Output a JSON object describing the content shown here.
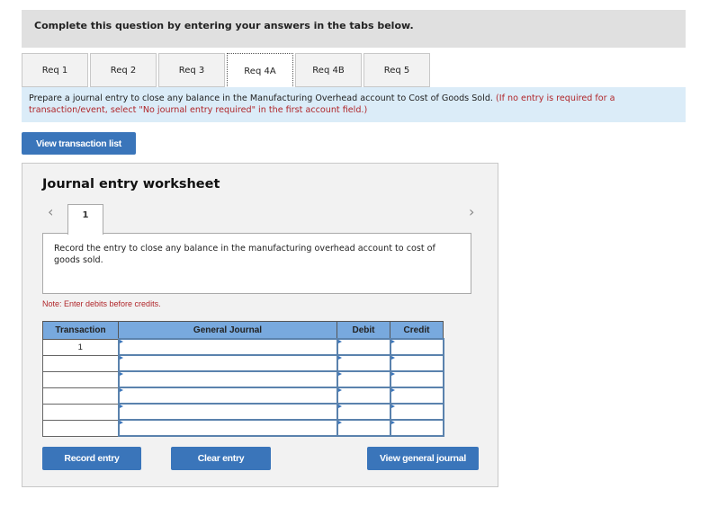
{
  "instruction": "Complete this question by entering your answers in the tabs below.",
  "tabs": [
    {
      "label": "Req 1",
      "active": false
    },
    {
      "label": "Req 2",
      "active": false
    },
    {
      "label": "Req 3",
      "active": false
    },
    {
      "label": "Req 4A",
      "active": true
    },
    {
      "label": "Req 4B",
      "active": false
    },
    {
      "label": "Req 5",
      "active": false
    }
  ],
  "prompt": {
    "main": "Prepare a journal entry to close any balance in the Manufacturing Overhead account to Cost of Goods Sold.",
    "hint": "(If no entry is required for a transaction/event, select \"No journal entry required\" in the first account field.)"
  },
  "view_transaction_list_label": "View transaction list",
  "worksheet": {
    "title": "Journal entry worksheet",
    "prev_icon": "chevron-left-icon",
    "next_icon": "chevron-right-icon",
    "entry_tab": "1",
    "description": "Record the entry to close any balance in the manufacturing overhead account to cost of goods sold.",
    "note": "Note: Enter debits before credits.",
    "table": {
      "headers": [
        "Transaction",
        "General Journal",
        "Debit",
        "Credit"
      ],
      "rows": [
        {
          "transaction": "1",
          "account": "",
          "debit": "",
          "credit": ""
        },
        {
          "transaction": "",
          "account": "",
          "debit": "",
          "credit": ""
        },
        {
          "transaction": "",
          "account": "",
          "debit": "",
          "credit": ""
        },
        {
          "transaction": "",
          "account": "",
          "debit": "",
          "credit": ""
        },
        {
          "transaction": "",
          "account": "",
          "debit": "",
          "credit": ""
        },
        {
          "transaction": "",
          "account": "",
          "debit": "",
          "credit": ""
        }
      ]
    },
    "buttons": {
      "record": "Record entry",
      "clear": "Clear entry",
      "view_journal": "View general journal"
    }
  }
}
